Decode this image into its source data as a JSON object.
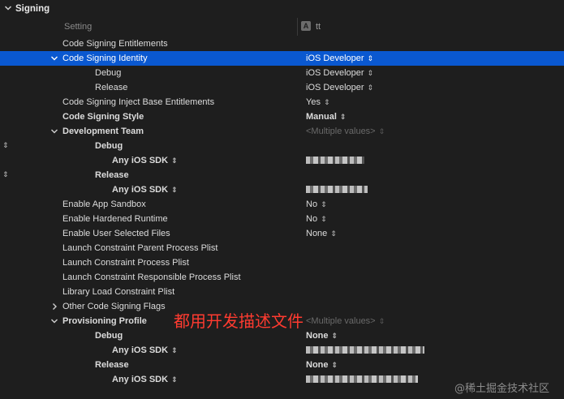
{
  "section": {
    "title": "Signing"
  },
  "header": {
    "setting": "Setting",
    "target": "tt",
    "target_icon": "app-target-icon"
  },
  "rows": [
    {
      "label": "Code Signing Entitlements",
      "value": ""
    },
    {
      "label": "Code Signing Identity",
      "value": "iOS Developer"
    },
    {
      "label": "Debug",
      "value": "iOS Developer"
    },
    {
      "label": "Release",
      "value": "iOS Developer"
    },
    {
      "label": "Code Signing Inject Base Entitlements",
      "value": "Yes"
    },
    {
      "label": "Code Signing Style",
      "value": "Manual"
    },
    {
      "label": "Development Team",
      "value": "<Multiple values>"
    },
    {
      "label": "Debug",
      "value": ""
    },
    {
      "label": "Any iOS SDK",
      "value": ""
    },
    {
      "label": "Release",
      "value": ""
    },
    {
      "label": "Any iOS SDK",
      "value": ""
    },
    {
      "label": "Enable App Sandbox",
      "value": "No"
    },
    {
      "label": "Enable Hardened Runtime",
      "value": "No"
    },
    {
      "label": "Enable User Selected Files",
      "value": "None"
    },
    {
      "label": "Launch Constraint Parent Process Plist",
      "value": ""
    },
    {
      "label": "Launch Constraint Process Plist",
      "value": ""
    },
    {
      "label": "Launch Constraint Responsible Process Plist",
      "value": ""
    },
    {
      "label": "Library Load Constraint Plist",
      "value": ""
    },
    {
      "label": "Other Code Signing Flags",
      "value": ""
    },
    {
      "label": "Provisioning Profile",
      "value": "<Multiple values>"
    },
    {
      "label": "Debug",
      "value": "None"
    },
    {
      "label": "Any iOS SDK",
      "value": ""
    },
    {
      "label": "Release",
      "value": "None"
    },
    {
      "label": "Any iOS SDK",
      "value": ""
    }
  ],
  "annotation": "都用开发描述文件",
  "watermark": "@稀土掘金技术社区",
  "colors": {
    "background": "#1e1e1e",
    "selection": "#0a58d0",
    "annotation": "#ff3b30"
  }
}
